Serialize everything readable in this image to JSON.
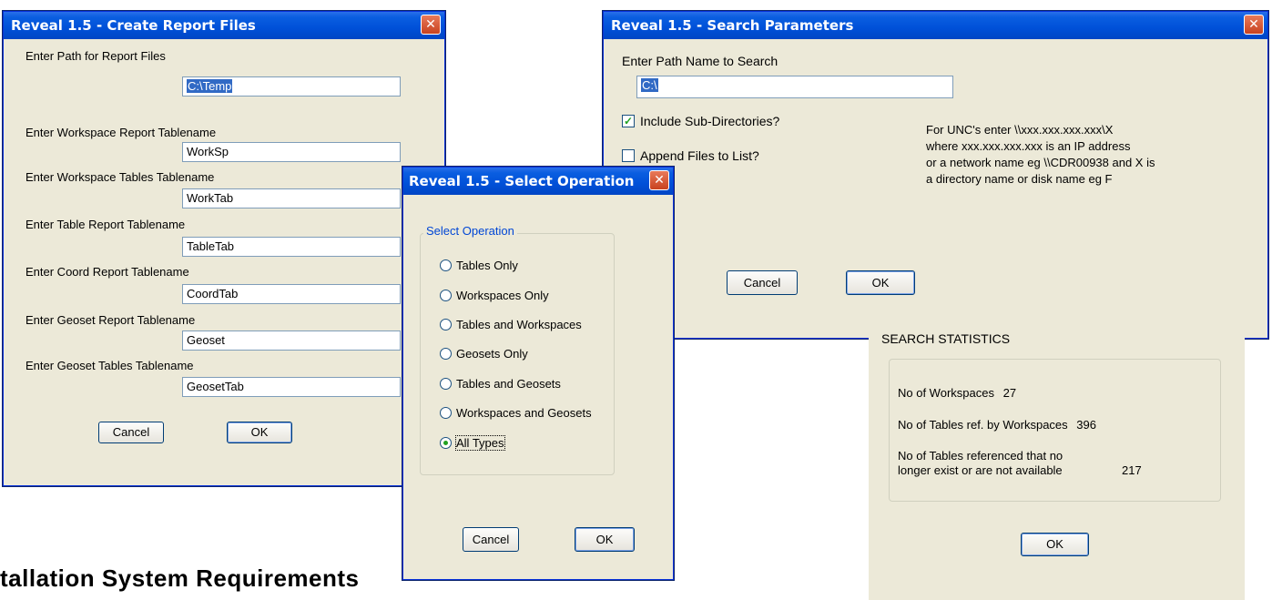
{
  "create_report": {
    "title": "Reveal 1.5 - Create Report Files",
    "path_label": "Enter Path for Report Files",
    "path_value": "C:\\Temp",
    "fields": [
      {
        "label": "Enter Workspace Report Tablename",
        "value": "WorkSp"
      },
      {
        "label": "Enter Workspace Tables Tablename",
        "value": "WorkTab"
      },
      {
        "label": "Enter Table Report Tablename",
        "value": "TableTab"
      },
      {
        "label": "Enter Coord Report Tablename",
        "value": "CoordTab"
      },
      {
        "label": "Enter Geoset Report Tablename",
        "value": "Geoset"
      },
      {
        "label": "Enter Geoset Tables Tablename",
        "value": "GeosetTab"
      }
    ],
    "cancel": "Cancel",
    "ok": "OK"
  },
  "search_params": {
    "title": "Reveal 1.5 - Search Parameters",
    "path_label": "Enter Path Name to Search",
    "path_value": "C:\\",
    "include_subdirs": {
      "label": "Include Sub-Directories?",
      "checked": true
    },
    "append_files": {
      "label": "Append Files to List?",
      "checked": false
    },
    "unc_help": [
      "For UNC's enter \\\\xxx.xxx.xxx.xxx\\X",
      "where xxx.xxx.xxx.xxx is an IP address",
      "or a network name eg \\\\CDR00938 and X is",
      "a directory name or disk name eg F"
    ],
    "cancel": "Cancel",
    "ok": "OK"
  },
  "select_operation": {
    "title": "Reveal 1.5 - Select Operation",
    "group_label": "Select Operation",
    "options": [
      "Tables Only",
      "Workspaces Only",
      "Tables and Workspaces",
      "Geosets Only",
      "Tables and Geosets",
      "Workspaces and Geosets",
      "All Types"
    ],
    "selected": "All Types",
    "cancel": "Cancel",
    "ok": "OK"
  },
  "search_stats": {
    "heading": "SEARCH STATISTICS",
    "workspaces_label": "No of Workspaces",
    "workspaces_value": "27",
    "tables_label": "No of Tables ref. by Workspaces",
    "tables_value": "396",
    "missing_label_1": "No of Tables referenced that no",
    "missing_label_2": "longer exist or are not available",
    "missing_value": "217",
    "ok": "OK"
  },
  "page_heading": "tallation System Requirements"
}
